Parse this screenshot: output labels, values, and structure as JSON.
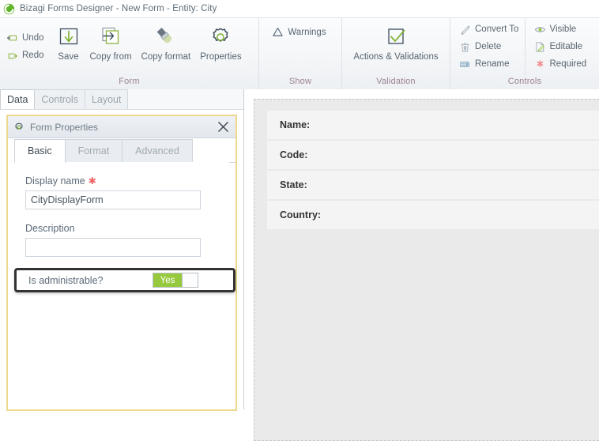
{
  "window": {
    "logo_icon": "bizagi-logo-icon",
    "title": "Bizagi Forms Designer  - New Form - Entity:  City"
  },
  "ribbon": {
    "groups": [
      {
        "name": "Form",
        "label": "Form",
        "small_commands": [
          {
            "label": "Undo",
            "icon": "undo-icon"
          },
          {
            "label": "Redo",
            "icon": "redo-icon"
          }
        ],
        "large_commands": [
          {
            "label": "Save",
            "icon": "save-icon"
          },
          {
            "label": "Copy from",
            "icon": "copy-from-icon"
          },
          {
            "label": "Copy format",
            "icon": "copy-format-icon"
          },
          {
            "label": "Properties",
            "icon": "gear-icon"
          }
        ]
      },
      {
        "name": "Show",
        "label": "Show",
        "small_commands": [
          {
            "label": "Warnings",
            "icon": "warning-triangle-icon"
          }
        ]
      },
      {
        "name": "Validation",
        "label": "Validation",
        "large_commands": [
          {
            "label": "Actions & Validations",
            "icon": "checkbox-check-icon"
          }
        ]
      },
      {
        "name": "Controls",
        "label": "Controls",
        "column_one": [
          {
            "label": "Convert To",
            "icon": "wand-icon"
          },
          {
            "label": "Delete",
            "icon": "trash-icon"
          },
          {
            "label": "Rename",
            "icon": "rename-icon"
          }
        ],
        "column_two": [
          {
            "label": "Visible",
            "icon": "eye-icon"
          },
          {
            "label": "Editable",
            "icon": "edit-page-icon"
          },
          {
            "label": "Required",
            "icon": "asterisk-icon"
          }
        ]
      }
    ]
  },
  "left_pane": {
    "tabs": [
      {
        "label": "Data",
        "active": true
      },
      {
        "label": "Controls",
        "active": false
      },
      {
        "label": "Layout",
        "active": false
      }
    ],
    "panel": {
      "icon": "gear-icon",
      "title": "Form Properties",
      "close_icon": "close-icon",
      "subtabs": [
        {
          "label": "Basic",
          "active": true
        },
        {
          "label": "Format",
          "active": false
        },
        {
          "label": "Advanced",
          "active": false
        }
      ],
      "fields": {
        "display_name": {
          "label": "Display name",
          "required_marker": "✱",
          "value": "CityDisplayForm",
          "placeholder": ""
        },
        "description": {
          "label": "Description",
          "value": "",
          "placeholder": ""
        },
        "is_administrable": {
          "label": "Is administrable?",
          "toggle_state": "Yes"
        }
      }
    }
  },
  "canvas": {
    "rows": [
      {
        "label": "Name:"
      },
      {
        "label": "Code:"
      },
      {
        "label": "State:"
      },
      {
        "label": "Country:"
      }
    ]
  },
  "colors": {
    "accent_green": "#96c93d",
    "group_label": "#9b7f93",
    "highlight_border": "#333333",
    "panel_border": "#ecd98e",
    "required_red": "#f06464"
  }
}
